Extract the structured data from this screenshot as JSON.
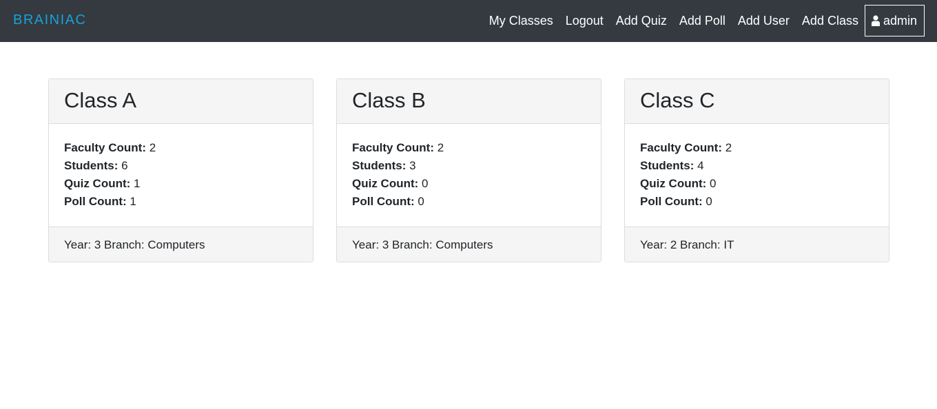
{
  "brand": "BRAINIAC",
  "nav": {
    "links": [
      "My Classes",
      "Logout",
      "Add Quiz",
      "Add Poll",
      "Add User",
      "Add Class"
    ],
    "user": {
      "icon": "user-icon",
      "label": "admin"
    }
  },
  "stat_labels": {
    "faculty": "Faculty Count:",
    "students": "Students:",
    "quiz": "Quiz Count:",
    "poll": "Poll Count:"
  },
  "footer_labels": {
    "year": "Year:",
    "branch": "Branch:"
  },
  "classes": [
    {
      "name": "Class A",
      "faculty": "2",
      "students": "6",
      "quiz": "1",
      "poll": "1",
      "year": "3",
      "branch": "Computers"
    },
    {
      "name": "Class B",
      "faculty": "2",
      "students": "3",
      "quiz": "0",
      "poll": "0",
      "year": "3",
      "branch": "Computers"
    },
    {
      "name": "Class C",
      "faculty": "2",
      "students": "4",
      "quiz": "0",
      "poll": "0",
      "year": "2",
      "branch": "IT"
    }
  ]
}
